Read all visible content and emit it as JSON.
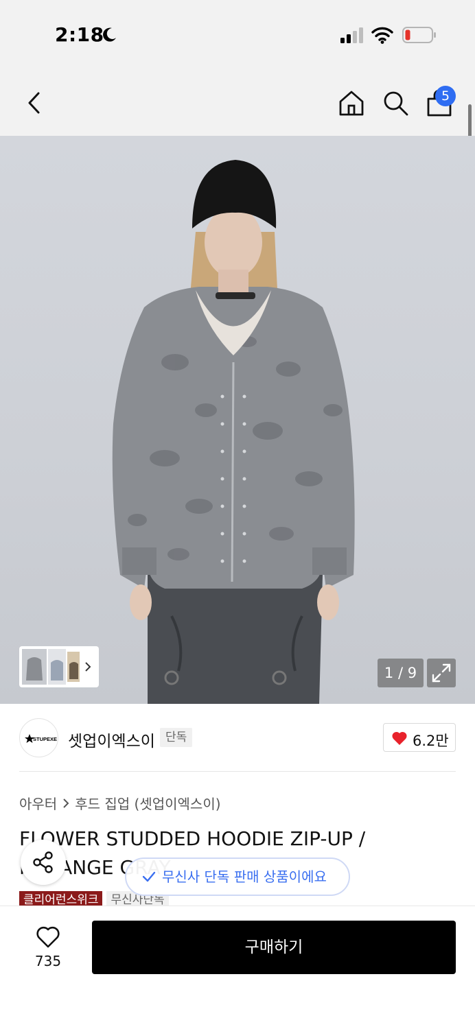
{
  "status_bar": {
    "time": "2:18"
  },
  "nav": {
    "cart_count": "5"
  },
  "gallery": {
    "counter": "1 / 9"
  },
  "brand": {
    "name": "셋업이엑스이",
    "tag": "단독",
    "logo_text": "STUPEXE",
    "likes": "6.2만"
  },
  "breadcrumb": {
    "category": "아우터",
    "subcategory": "후드 집업 (셋업이엑스이)"
  },
  "product": {
    "title": "FLOWER STUDDED HOODIE ZIP-UP / MELANGE GRAY"
  },
  "notice": {
    "exclusive": "무신사 단독 판매 상품이에요"
  },
  "badges": {
    "red": "클리어런스위크",
    "gray": "무신사단독"
  },
  "bottom": {
    "wish_count": "735",
    "buy_label": "구매하기"
  },
  "colors": {
    "accent_blue": "#2f6df2",
    "heart_red": "#e8222b",
    "buy_black": "#000000",
    "badge_red": "#8b1a1a"
  },
  "icons": [
    "moon-icon",
    "signal-icon",
    "wifi-icon",
    "battery-icon",
    "back-icon",
    "home-icon",
    "search-icon",
    "cart-icon",
    "expand-icon",
    "chevron-right-icon",
    "heart-icon",
    "share-icon",
    "check-icon"
  ]
}
